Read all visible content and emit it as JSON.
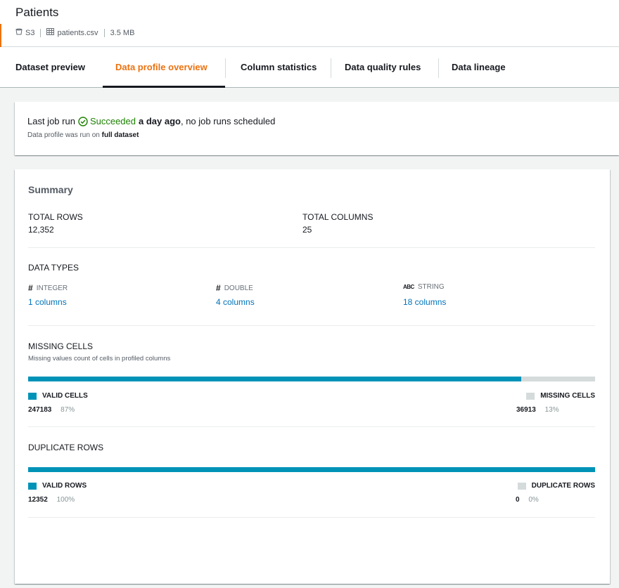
{
  "header": {
    "title": "Patients",
    "source": "S3",
    "file": "patients.csv",
    "size": "3.5 MB"
  },
  "tabs": [
    {
      "label": "Dataset preview"
    },
    {
      "label": "Data profile overview",
      "active": true
    },
    {
      "label": "Column statistics"
    },
    {
      "label": "Data quality rules"
    },
    {
      "label": "Data lineage"
    }
  ],
  "job": {
    "prefix": "Last job run",
    "status": "Succeeded",
    "when": "a day ago",
    "suffix": ", no job runs scheduled",
    "sub_prefix": "Data profile was run on",
    "sub_scope": "full dataset"
  },
  "summary": {
    "title": "Summary",
    "total_rows_label": "TOTAL ROWS",
    "total_rows": "12,352",
    "total_columns_label": "TOTAL COLUMNS",
    "total_columns": "25"
  },
  "data_types": {
    "title": "DATA TYPES",
    "items": [
      {
        "glyph": "#",
        "label": "INTEGER",
        "link": "1 columns"
      },
      {
        "glyph": "#",
        "label": "DOUBLE",
        "link": "4 columns"
      },
      {
        "glyph": "ABC",
        "label": "STRING",
        "link": "18 columns"
      }
    ]
  },
  "missing_cells": {
    "title": "MISSING CELLS",
    "description": "Missing values count of cells in profiled columns",
    "valid_fraction": 0.87,
    "valid_label": "VALID CELLS",
    "valid_count": "247183",
    "valid_pct": "87%",
    "missing_label": "MISSING CELLS",
    "missing_count": "36913",
    "missing_pct": "13%"
  },
  "duplicate_rows": {
    "title": "DUPLICATE ROWS",
    "valid_fraction": 1.0,
    "valid_label": "VALID ROWS",
    "valid_count": "12352",
    "valid_pct": "100%",
    "dup_label": "DUPLICATE ROWS",
    "dup_count": "0",
    "dup_pct": "0%"
  },
  "colors": {
    "accent": "#ec7211",
    "success": "#1d8102",
    "link": "#0073bb",
    "bar_valid": "#0093b8",
    "bar_other": "#d5dbdb"
  }
}
